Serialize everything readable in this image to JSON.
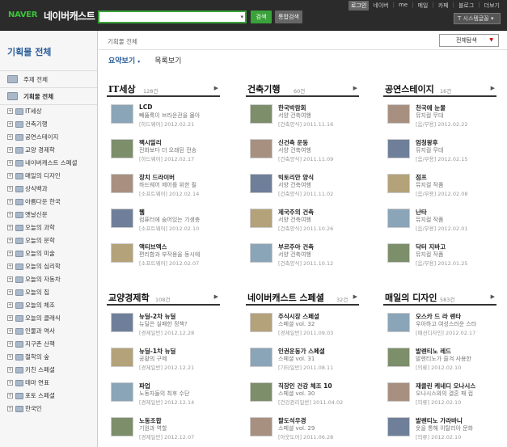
{
  "header": {
    "logo": "NAVER",
    "title": "네이버캐스트",
    "search_value": "",
    "search_button": "검색",
    "all_search_button": "통합검색",
    "nav": [
      "로그인",
      "네이버",
      "me",
      "메일",
      "카페",
      "블로그",
      "더보기"
    ],
    "system_menu": "시스템글꼴"
  },
  "sidebar": {
    "title": "기획물 전체",
    "top_items": [
      "주제 전체",
      "기획물 전체"
    ],
    "items": [
      "IT세상",
      "건축기행",
      "공연스테이지",
      "교양 경제학",
      "네이버캐스트 스페셜",
      "매일의 디자인",
      "상식백과",
      "아름다운 한국",
      "옛날신문",
      "오늘의 과학",
      "오늘의 문학",
      "오늘의 미술",
      "오늘의 심리학",
      "오늘의 자동차",
      "오늘의 집",
      "오늘의 체조",
      "오늘의 클래식",
      "인물과 역사",
      "지구촌 산책",
      "철학의 숲",
      "키친 스페셜",
      "테마 연표",
      "포토 스페셜",
      "한국인"
    ]
  },
  "main": {
    "breadcrumb": "기획물 전체",
    "filter": "전체탐색",
    "tabs": [
      "요약보기",
      "목록보기"
    ],
    "sections": [
      {
        "title": "IT세상",
        "count": "128건",
        "items": [
          {
            "title": "LCD",
            "desc": "빼뚫룩이 브라운관을 몰아",
            "meta": "[하드웨어] 2012.02.21"
          },
          {
            "title": "팩시밀리",
            "desc": "전화보다 더 오래된 전송",
            "meta": "[하드웨어] 2012.02.17"
          },
          {
            "title": "장치 드라이버",
            "desc": "하드웨어 제어를 위한 필",
            "meta": "[소프트웨어] 2012.02.14"
          },
          {
            "title": "웹",
            "desc": "컴퓨터에 숨어있는 기생충",
            "meta": "[소프트웨어] 2012.02.10"
          },
          {
            "title": "액티브엑스",
            "desc": "편리함과 부작용을 동시에",
            "meta": "[소프트웨어] 2012.02.07"
          }
        ]
      },
      {
        "title": "건축기행",
        "count": "60건",
        "items": [
          {
            "title": "한국박람회",
            "desc": "서양 건축여행",
            "meta": "[건축양식] 2011.11.16"
          },
          {
            "title": "신건축 운동",
            "desc": "서양 건축여행",
            "meta": "[건축양식] 2011.11.09"
          },
          {
            "title": "빅토리안 양식",
            "desc": "서양 건축여행",
            "meta": "[건축양식] 2011.11.02"
          },
          {
            "title": "제국주의 건축",
            "desc": "서양 건축여행",
            "meta": "[건축양식] 2011.10.26"
          },
          {
            "title": "부르주아 건축",
            "desc": "서양 건축여행",
            "meta": "[건축양식] 2011.10.12"
          }
        ]
      },
      {
        "title": "공연스테이지",
        "count": "16건",
        "items": [
          {
            "title": "천국에 눈물",
            "desc": "뮤지컬 무대",
            "meta": "[음/무용] 2012.02.22"
          },
          {
            "title": "엄청왕후",
            "desc": "뮤지컬 무대",
            "meta": "[음/무용] 2012.02.15"
          },
          {
            "title": "점프",
            "desc": "뮤지컬 작품",
            "meta": "[음/무용] 2012.02.08"
          },
          {
            "title": "난타",
            "desc": "뮤지컬 작품",
            "meta": "[음/무용] 2012.02.01"
          },
          {
            "title": "닥터 지바고",
            "desc": "뮤지컬 작품",
            "meta": "[음/무용] 2012.01.25"
          }
        ]
      },
      {
        "title": "교양경제학",
        "count": "108건",
        "items": [
          {
            "title": "뉴딜-2차 뉴딜",
            "desc": "뉴딜은 실패한 정책?",
            "meta": "[경제일반] 2012.12.28"
          },
          {
            "title": "뉴딜-1차 뉴딜",
            "desc": "공황의 구제",
            "meta": "[경제일반] 2012.12.21"
          },
          {
            "title": "파업",
            "desc": "노동자들의 최후 수단",
            "meta": "[경제일반] 2012.12.14"
          },
          {
            "title": "노동조합",
            "desc": "기원과 역할",
            "meta": "[경제일반] 2012.12.07"
          }
        ]
      },
      {
        "title": "네이버캐스트 스페셜",
        "count": "32건",
        "items": [
          {
            "title": "주식시장 스페셜",
            "desc": "스페셜 vol. 32",
            "meta": "[경제일반] 2011.09.03"
          },
          {
            "title": "인권운동가 스페셜",
            "desc": "스페셜 vol. 31",
            "meta": "[기타일반] 2011.08.11"
          },
          {
            "title": "직장인 건강 체조 10",
            "desc": "스페셜 vol. 30",
            "meta": "[건강관리일반] 2011.04.02"
          },
          {
            "title": "팔도석우경",
            "desc": "스페셜 vol. 29",
            "meta": "[아웃도어] 2011.06.28"
          }
        ]
      },
      {
        "title": "매일의 디자인",
        "count": "583건",
        "items": [
          {
            "title": "오스카 드 라 렌타",
            "desc": "우아하고 여성스러운 스타",
            "meta": "[패션디자인] 2012.02.17"
          },
          {
            "title": "발렌티노 레드",
            "desc": "발렌티노가 즐겨 사용한",
            "meta": "[의류] 2012.02.10"
          },
          {
            "title": "재클린 케네디 오나시스",
            "desc": "오나시스와의 결혼 패 컵",
            "meta": "[의류] 2012.02.10"
          },
          {
            "title": "발렌티노 가라바니",
            "desc": "옷을 통해 이탈리아 문화",
            "meta": "[의류] 2012.02.10"
          }
        ]
      }
    ]
  }
}
